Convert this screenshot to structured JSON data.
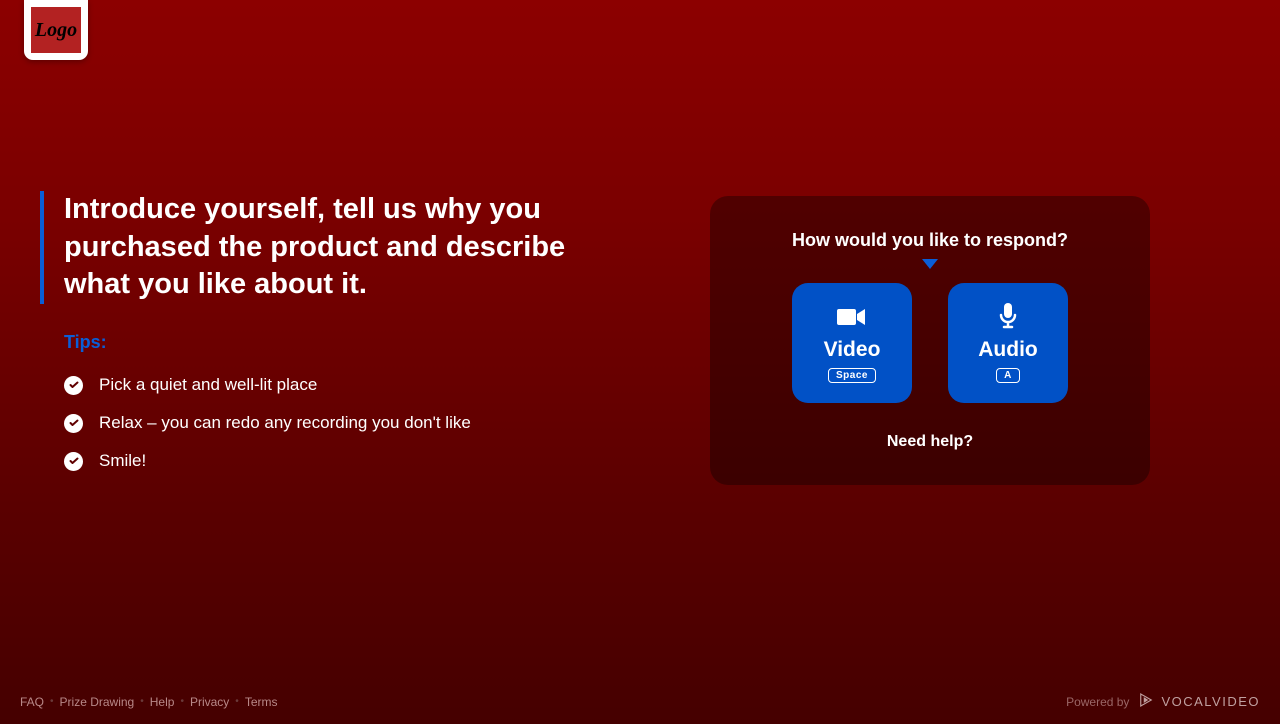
{
  "logo": {
    "text": "Logo"
  },
  "prompt": {
    "heading": "Introduce yourself, tell us why you purchased the product and describe what you like about it."
  },
  "tips": {
    "label": "Tips:",
    "items": [
      "Pick a quiet and well-lit place",
      "Relax – you can redo any recording you don't like",
      "Smile!"
    ]
  },
  "response_card": {
    "title": "How would you like to respond?",
    "video": {
      "label": "Video",
      "key": "Space"
    },
    "audio": {
      "label": "Audio",
      "key": "A"
    },
    "help": "Need help?"
  },
  "footer": {
    "links": [
      "FAQ",
      "Prize Drawing",
      "Help",
      "Privacy",
      "Terms"
    ],
    "powered_by": "Powered by",
    "brand": "VOCALVIDEO"
  }
}
